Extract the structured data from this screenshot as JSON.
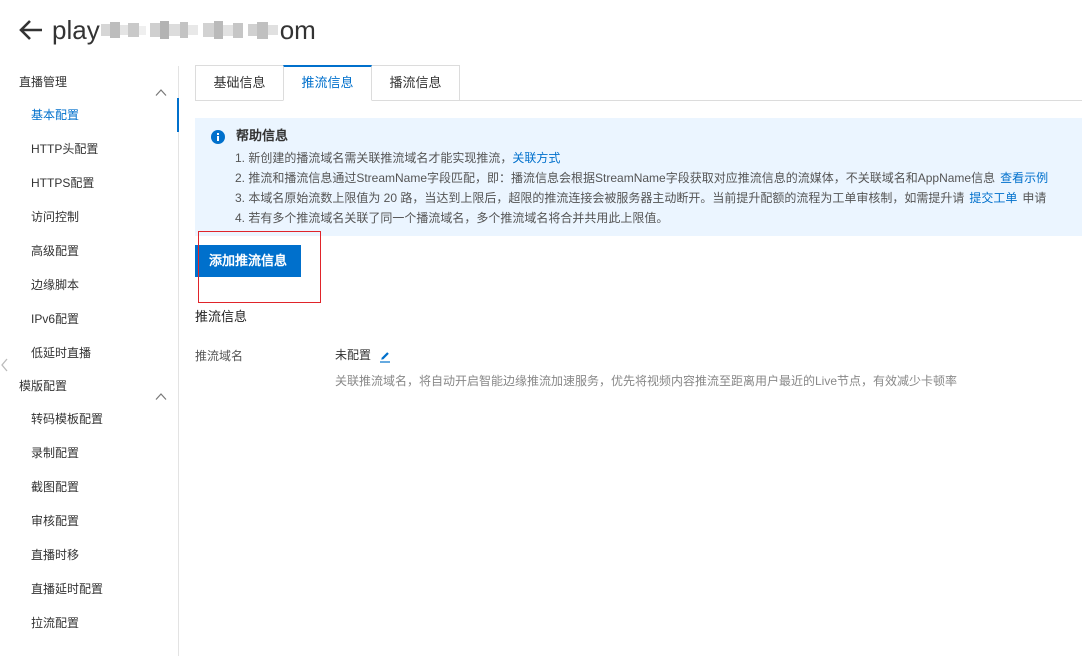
{
  "header": {
    "title_prefix": "play",
    "title_suffix": "om"
  },
  "sidebar": {
    "groups": [
      {
        "label": "直播管理",
        "items": [
          "基本配置",
          "HTTP头配置",
          "HTTPS配置",
          "访问控制",
          "高级配置",
          "边缘脚本",
          "IPv6配置",
          "低延时直播"
        ]
      },
      {
        "label": "模版配置",
        "items": [
          "转码模板配置",
          "录制配置",
          "截图配置",
          "审核配置",
          "直播时移",
          "直播延时配置",
          "拉流配置"
        ]
      }
    ],
    "active_item": "基本配置"
  },
  "tabs": [
    {
      "label": "基础信息",
      "active": false
    },
    {
      "label": "推流信息",
      "active": true
    },
    {
      "label": "播流信息",
      "active": false
    }
  ],
  "help": {
    "title": "帮助信息",
    "lines": [
      {
        "text": "1. 新创建的播流域名需关联推流域名才能实现推流，",
        "link": "关联方式"
      },
      {
        "text": "2. 推流和播流信息通过StreamName字段匹配，即：播流信息会根据StreamName字段获取对应推流信息的流媒体，不关联域名和AppName信息",
        "link": "查看示例"
      },
      {
        "text": "3. 本域名原始流数上限值为 20 路，当达到上限后，超限的推流连接会被服务器主动断开。当前提升配额的流程为工单审核制，如需提升请",
        "link": "提交工单",
        "tail": "申请"
      },
      {
        "text": "4. 若有多个推流域名关联了同一个播流域名，多个推流域名将合并共用此上限值。"
      }
    ]
  },
  "add_button": "添加推流信息",
  "section": {
    "title": "推流信息",
    "field_label": "推流域名",
    "field_value": "未配置",
    "field_desc": "关联推流域名，将自动开启智能边缘推流加速服务，优先将视频内容推流至距离用户最近的Live节点，有效减少卡顿率"
  },
  "icons": {
    "back": "arrow-left-icon",
    "group_toggle": "chevron-up-icon",
    "info": "info-icon",
    "edit": "pencil-icon",
    "collapse": "chevron-left-icon"
  },
  "colors": {
    "accent": "#0070cc",
    "help_bg": "#ebf5ff",
    "annotation": "#e0242a",
    "text": "#333333",
    "muted": "#888888"
  }
}
